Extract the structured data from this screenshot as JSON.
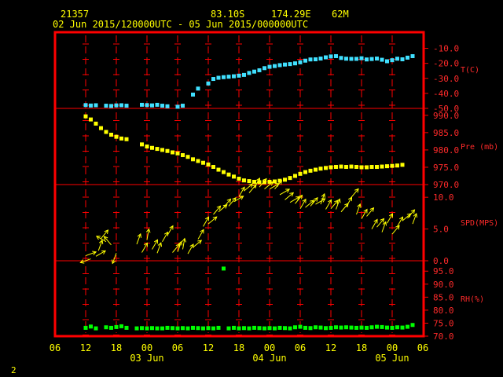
{
  "header": {
    "station": "21357",
    "lat": "83.10S",
    "lon": "174.29E",
    "elev": "62M",
    "range": "02 Jun 2015/120000UTC - 05 Jun 2015/000000UTC"
  },
  "corner_label": "2",
  "colors": {
    "frame": "#ff0000",
    "grid": "#ff0000",
    "text": "#ffff00",
    "temp": "#40e0ff",
    "pressure": "#ffff00",
    "wind": "#ffff00",
    "rh": "#00ff00",
    "axis_labels": "#ff2a2a"
  },
  "chart_data": {
    "type": "scatter",
    "x_unit": "hours since 02 Jun 06 UTC",
    "x_ticks": [
      "06",
      "12",
      "18",
      "00",
      "06",
      "12",
      "18",
      "00",
      "06",
      "12",
      "18",
      "00",
      "06"
    ],
    "date_labels": [
      {
        "text": "03 Jun",
        "at": 18
      },
      {
        "text": "04 Jun",
        "at": 42
      },
      {
        "text": "05 Jun",
        "at": 66
      }
    ],
    "panels": [
      {
        "name": "temperature",
        "label": "T(C)",
        "ticks": [
          "-10.0",
          "-20.0",
          "-30.0",
          "-40.0",
          "-50.0"
        ],
        "tick_values": [
          -10,
          -20,
          -30,
          -40,
          -50
        ],
        "ylim": [
          -50,
          -5
        ],
        "series": [
          [
            6,
            -47.8
          ],
          [
            7,
            -48.1
          ],
          [
            8,
            -47.9
          ],
          [
            10,
            -48.2
          ],
          [
            11,
            -48.4
          ],
          [
            12,
            -48.0
          ],
          [
            13,
            -47.9
          ],
          [
            14,
            -48.2
          ],
          [
            17,
            -47.6
          ],
          [
            18,
            -47.8
          ],
          [
            19,
            -48.0
          ],
          [
            20,
            -47.6
          ],
          [
            21,
            -48.2
          ],
          [
            22,
            -48.6
          ],
          [
            24,
            -48.9
          ],
          [
            25,
            -48.2
          ],
          [
            27,
            -40.8
          ],
          [
            28,
            -36.8
          ],
          [
            30,
            -33.4
          ],
          [
            31,
            -30.4
          ],
          [
            32,
            -29.6
          ],
          [
            33,
            -29.2
          ],
          [
            34,
            -28.9
          ],
          [
            35,
            -28.6
          ],
          [
            36,
            -28.2
          ],
          [
            37,
            -27.7
          ],
          [
            38,
            -26.4
          ],
          [
            39,
            -25.5
          ],
          [
            40,
            -24.6
          ],
          [
            41,
            -23.2
          ],
          [
            42,
            -22.3
          ],
          [
            43,
            -21.8
          ],
          [
            44,
            -21.2
          ],
          [
            45,
            -20.8
          ],
          [
            46,
            -20.5
          ],
          [
            47,
            -20.0
          ],
          [
            48,
            -19.3
          ],
          [
            49,
            -18.2
          ],
          [
            50,
            -17.4
          ],
          [
            51,
            -17.3
          ],
          [
            52,
            -16.8
          ],
          [
            53,
            -16.0
          ],
          [
            54,
            -15.4
          ],
          [
            55,
            -15.2
          ],
          [
            56,
            -16.4
          ],
          [
            57,
            -16.9
          ],
          [
            58,
            -17.0
          ],
          [
            59,
            -17.0
          ],
          [
            60,
            -16.6
          ],
          [
            61,
            -17.4
          ],
          [
            62,
            -17.1
          ],
          [
            63,
            -16.8
          ],
          [
            64,
            -17.6
          ],
          [
            65,
            -18.6
          ],
          [
            66,
            -17.9
          ],
          [
            67,
            -16.9
          ],
          [
            68,
            -17.3
          ],
          [
            69,
            -16.2
          ],
          [
            70,
            -15.2
          ]
        ]
      },
      {
        "name": "pressure",
        "label": "Pre (mb)",
        "ticks": [
          "990.0",
          "985.0",
          "980.0",
          "975.0",
          "970.0"
        ],
        "tick_values": [
          990,
          985,
          980,
          975,
          970
        ],
        "ylim": [
          970,
          992
        ],
        "series": [
          [
            6,
            989.7
          ],
          [
            7,
            988.8
          ],
          [
            8,
            987.6
          ],
          [
            9,
            986.3
          ],
          [
            10,
            985.2
          ],
          [
            11,
            984.4
          ],
          [
            12,
            983.8
          ],
          [
            13,
            983.3
          ],
          [
            14,
            983.1
          ],
          [
            17,
            981.6
          ],
          [
            18,
            981.0
          ],
          [
            19,
            980.6
          ],
          [
            20,
            980.3
          ],
          [
            21,
            980.0
          ],
          [
            22,
            979.7
          ],
          [
            23,
            979.3
          ],
          [
            24,
            979.0
          ],
          [
            25,
            978.5
          ],
          [
            26,
            978.0
          ],
          [
            27,
            977.3
          ],
          [
            28,
            976.8
          ],
          [
            29,
            976.3
          ],
          [
            30,
            975.8
          ],
          [
            31,
            975.1
          ],
          [
            32,
            974.3
          ],
          [
            33,
            973.6
          ],
          [
            34,
            972.9
          ],
          [
            35,
            972.3
          ],
          [
            36,
            971.7
          ],
          [
            37,
            971.2
          ],
          [
            38,
            971.0
          ],
          [
            39,
            970.8
          ],
          [
            40,
            970.7
          ],
          [
            41,
            970.7
          ],
          [
            42,
            970.8
          ],
          [
            43,
            970.9
          ],
          [
            44,
            971.1
          ],
          [
            45,
            971.4
          ],
          [
            46,
            971.9
          ],
          [
            47,
            972.5
          ],
          [
            48,
            973.1
          ],
          [
            49,
            973.6
          ],
          [
            50,
            974.0
          ],
          [
            51,
            974.3
          ],
          [
            52,
            974.6
          ],
          [
            53,
            974.8
          ],
          [
            54,
            975.0
          ],
          [
            55,
            975.1
          ],
          [
            56,
            975.2
          ],
          [
            57,
            975.1
          ],
          [
            58,
            975.2
          ],
          [
            59,
            975.1
          ],
          [
            60,
            975.0
          ],
          [
            61,
            975.0
          ],
          [
            62,
            975.1
          ],
          [
            63,
            975.1
          ],
          [
            64,
            975.2
          ],
          [
            65,
            975.3
          ],
          [
            66,
            975.4
          ],
          [
            67,
            975.5
          ],
          [
            68,
            975.7
          ]
        ]
      },
      {
        "name": "wind",
        "label": "SPD(MPS)",
        "ticks": [
          "10.0",
          "5.0",
          "0.0"
        ],
        "tick_values": [
          10,
          5,
          0
        ],
        "ylim": [
          0,
          12
        ],
        "series": [
          [
            6,
            0.8,
            70
          ],
          [
            7,
            0.3,
            250
          ],
          [
            8,
            0.7,
            60
          ],
          [
            8.5,
            1.6,
            20
          ],
          [
            9,
            3.5,
            40
          ],
          [
            10,
            3.0,
            300
          ],
          [
            11,
            2.5,
            320
          ],
          [
            12,
            1.2,
            200
          ],
          [
            16,
            2.6,
            20
          ],
          [
            17,
            1.3,
            30
          ],
          [
            18,
            3.3,
            10
          ],
          [
            19,
            1.8,
            30
          ],
          [
            20,
            1.2,
            20
          ],
          [
            21,
            3.0,
            30
          ],
          [
            22,
            4.0,
            30
          ],
          [
            23,
            1.3,
            40
          ],
          [
            24,
            1.4,
            20
          ],
          [
            25,
            1.8,
            10
          ],
          [
            26,
            1.1,
            30
          ],
          [
            27,
            2.1,
            50
          ],
          [
            28,
            3.4,
            30
          ],
          [
            29,
            5.4,
            30
          ],
          [
            30,
            5.8,
            50
          ],
          [
            31,
            7.3,
            40
          ],
          [
            32,
            7.7,
            50
          ],
          [
            33,
            8.4,
            40
          ],
          [
            34,
            8.6,
            40
          ],
          [
            35,
            9.3,
            60
          ],
          [
            36,
            10.1,
            30
          ],
          [
            37,
            11.0,
            50
          ],
          [
            38,
            10.7,
            40
          ],
          [
            39,
            11.5,
            30
          ],
          [
            40,
            11.6,
            40
          ],
          [
            41,
            11.3,
            50
          ],
          [
            42,
            11.3,
            60
          ],
          [
            43,
            11.3,
            40
          ],
          [
            44,
            10.4,
            60
          ],
          [
            45,
            9.6,
            50
          ],
          [
            46,
            9.2,
            60
          ],
          [
            47,
            9.0,
            40
          ],
          [
            48,
            8.2,
            30
          ],
          [
            49,
            8.4,
            50
          ],
          [
            50,
            8.6,
            40
          ],
          [
            51,
            8.9,
            60
          ],
          [
            52,
            8.9,
            20
          ],
          [
            53,
            8.1,
            30
          ],
          [
            54,
            8.2,
            40
          ],
          [
            55,
            8.1,
            20
          ],
          [
            56,
            7.7,
            40
          ],
          [
            57,
            8.5,
            30
          ],
          [
            58,
            10.0,
            40
          ],
          [
            59,
            7.3,
            20
          ],
          [
            60,
            6.6,
            30
          ],
          [
            61,
            7.0,
            40
          ],
          [
            62,
            5.0,
            30
          ],
          [
            63,
            5.3,
            40
          ],
          [
            64,
            4.5,
            20
          ],
          [
            65,
            5.9,
            30
          ],
          [
            66,
            4.2,
            40
          ],
          [
            67,
            5.4,
            30
          ],
          [
            68,
            6.3,
            50
          ],
          [
            69,
            6.7,
            40
          ],
          [
            70,
            5.8,
            20
          ]
        ]
      },
      {
        "name": "rh",
        "label": "RH(%)",
        "ticks": [
          "95.0",
          "90.0",
          "85.0",
          "80.0",
          "75.0",
          "70.0"
        ],
        "tick_values": [
          95,
          90,
          85,
          80,
          75,
          70
        ],
        "ylim": [
          70,
          99
        ],
        "series": [
          [
            6,
            73.2
          ],
          [
            7,
            73.7
          ],
          [
            8,
            73.0
          ],
          [
            10,
            73.4
          ],
          [
            11,
            73.2
          ],
          [
            12,
            73.5
          ],
          [
            13,
            73.8
          ],
          [
            14,
            73.2
          ],
          [
            16,
            73.0
          ],
          [
            17,
            73.1
          ],
          [
            18,
            73.0
          ],
          [
            19,
            73.1
          ],
          [
            20,
            73.0
          ],
          [
            21,
            73.0
          ],
          [
            22,
            73.2
          ],
          [
            23,
            73.1
          ],
          [
            24,
            73.0
          ],
          [
            25,
            73.1
          ],
          [
            26,
            73.0
          ],
          [
            27,
            73.2
          ],
          [
            28,
            73.1
          ],
          [
            29,
            73.0
          ],
          [
            30,
            73.1
          ],
          [
            31,
            73.0
          ],
          [
            32,
            73.2
          ],
          [
            33,
            96.0
          ],
          [
            34,
            73.0
          ],
          [
            35,
            73.2
          ],
          [
            36,
            73.0
          ],
          [
            37,
            73.1
          ],
          [
            38,
            73.0
          ],
          [
            39,
            73.2
          ],
          [
            40,
            73.1
          ],
          [
            41,
            73.0
          ],
          [
            42,
            73.1
          ],
          [
            43,
            73.0
          ],
          [
            44,
            73.2
          ],
          [
            45,
            73.1
          ],
          [
            46,
            73.0
          ],
          [
            47,
            73.4
          ],
          [
            48,
            73.6
          ],
          [
            49,
            73.2
          ],
          [
            50,
            73.1
          ],
          [
            51,
            73.4
          ],
          [
            52,
            73.3
          ],
          [
            53,
            73.1
          ],
          [
            54,
            73.2
          ],
          [
            55,
            73.4
          ],
          [
            56,
            73.3
          ],
          [
            57,
            73.4
          ],
          [
            58,
            73.3
          ],
          [
            59,
            73.2
          ],
          [
            60,
            73.3
          ],
          [
            61,
            73.2
          ],
          [
            62,
            73.4
          ],
          [
            63,
            73.6
          ],
          [
            64,
            73.5
          ],
          [
            65,
            73.3
          ],
          [
            66,
            73.2
          ],
          [
            67,
            73.4
          ],
          [
            68,
            73.3
          ],
          [
            69,
            73.6
          ],
          [
            70,
            74.3
          ]
        ]
      }
    ]
  }
}
